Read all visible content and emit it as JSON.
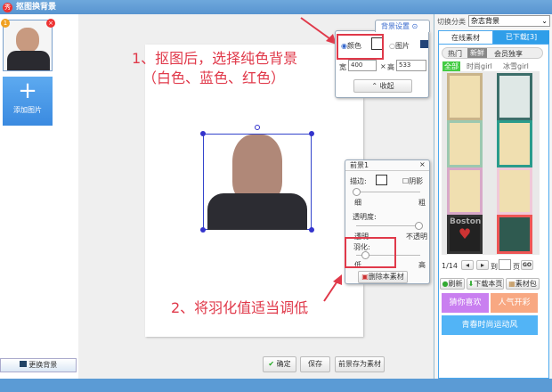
{
  "window": {
    "title": "抠图换背景",
    "logo": "秀"
  },
  "left": {
    "thumb_index": "1",
    "add_label": "添加图片",
    "add_icon": "+",
    "change_bg": "更换背景"
  },
  "annotations": {
    "step1_line1": "1、抠图后，选择纯色背景",
    "step1_line2": "（白色、蓝色、红色）",
    "step2": "2、将羽化值适当调低"
  },
  "bg_settings": {
    "title": "背景设置",
    "color_label": "颜色",
    "image_label": "图片",
    "width_label": "宽",
    "width_value": "400",
    "x": "×",
    "height_label": "高",
    "height_value": "533",
    "collapse": "收起",
    "selected": "color",
    "color": "#ffffff"
  },
  "foreground": {
    "title": "前景1",
    "stroke": "描边:",
    "shadow": "阴影",
    "thin": "细",
    "thick": "粗",
    "opacity": "透明度:",
    "transparent": "透明",
    "opaque": "不透明",
    "feather": "羽化:",
    "low": "低",
    "high": "高",
    "delete": "删除本素材",
    "stroke_level": 0,
    "opacity_level": 100,
    "feather_level": 15
  },
  "bottom": {
    "confirm": "确定",
    "save": "保存",
    "save_fg": "前景存为素材"
  },
  "right": {
    "switch_label": "切换分类",
    "category": "杂志背景",
    "tab_online": "在线素材",
    "tab_downloaded": "已下载[3]",
    "subtabs": [
      "热门",
      "新鲜",
      "会员独享"
    ],
    "filters": [
      "全部",
      "时尚girl",
      "冰雪girl"
    ],
    "page": "1/14",
    "goto": "到",
    "page_unit": "页",
    "go": "GO",
    "refresh": "刷新",
    "download_page": "下载本页",
    "pack": "素材包",
    "promo1": "猜你喜欢",
    "promo2": "人气开彩",
    "promo3": "青春时尚运动风",
    "boston": "Boston"
  }
}
